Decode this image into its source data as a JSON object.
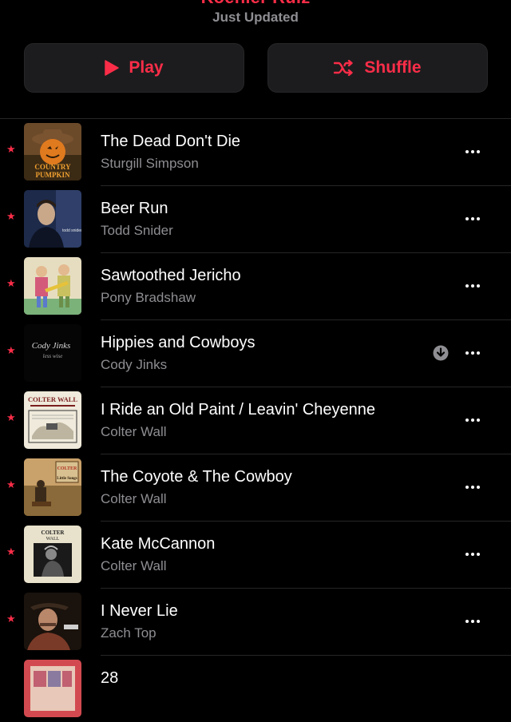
{
  "header": {
    "playlist_title": "Koehler Ruiz",
    "subtitle": "Just Updated"
  },
  "actions": {
    "play_label": "Play",
    "shuffle_label": "Shuffle"
  },
  "accent_color": "#fa2d48",
  "tracks": [
    {
      "title": "The Dead Don't Die",
      "artist": "Sturgill Simpson",
      "favorite": true,
      "downloaded": false,
      "art_text": "COUNTRY PUMPKIN"
    },
    {
      "title": "Beer Run",
      "artist": "Todd Snider",
      "favorite": true,
      "downloaded": false,
      "art_text": "todd snider"
    },
    {
      "title": "Sawtoothed Jericho",
      "artist": "Pony Bradshaw",
      "favorite": true,
      "downloaded": false,
      "art_text": ""
    },
    {
      "title": "Hippies and Cowboys",
      "artist": "Cody Jinks",
      "favorite": true,
      "downloaded": true,
      "art_text": "Cody Jinks"
    },
    {
      "title": "I Ride an Old Paint / Leavin' Cheyenne",
      "artist": "Colter Wall",
      "favorite": true,
      "downloaded": false,
      "art_text": "COLTER WALL"
    },
    {
      "title": "The Coyote & The Cowboy",
      "artist": "Colter Wall",
      "favorite": true,
      "downloaded": false,
      "art_text": "Little Songs"
    },
    {
      "title": "Kate McCannon",
      "artist": "Colter Wall",
      "favorite": true,
      "downloaded": false,
      "art_text": "COLTER WALL"
    },
    {
      "title": "I Never Lie",
      "artist": "Zach Top",
      "favorite": true,
      "downloaded": false,
      "art_text": ""
    },
    {
      "title": "28",
      "artist": "",
      "favorite": false,
      "downloaded": false,
      "art_text": ""
    }
  ]
}
